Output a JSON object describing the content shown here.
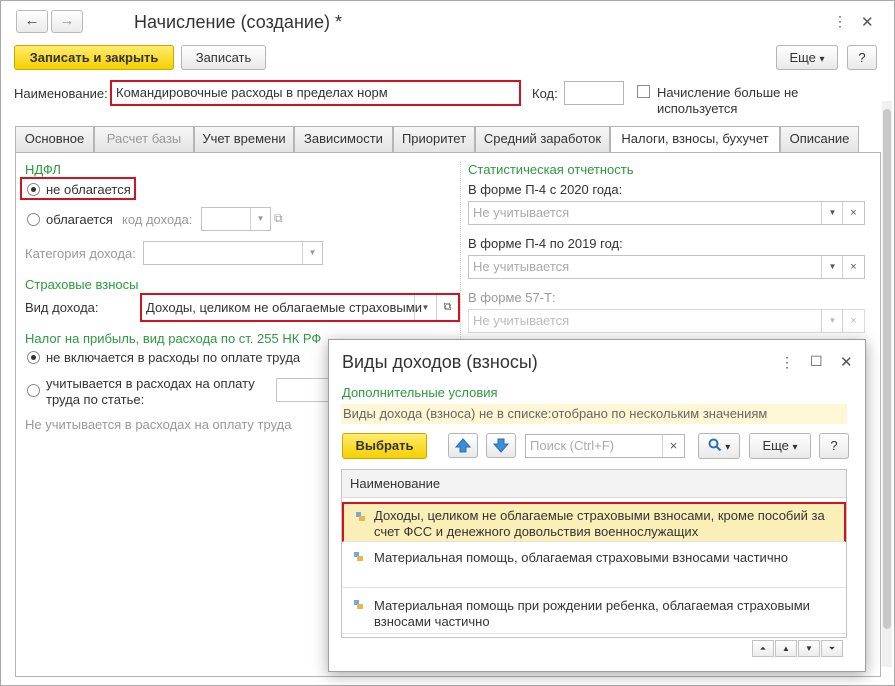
{
  "window": {
    "title": "Начисление (создание) *",
    "back_icon": "←",
    "forward_icon": "→",
    "more_icon": "⋮",
    "maximize_icon": "☐",
    "close_icon": "✕"
  },
  "toolbar": {
    "save_close_label": "Записать и закрыть",
    "save_label": "Записать",
    "more_label": "Еще",
    "more_arrow": "▾",
    "help_label": "?"
  },
  "header": {
    "name_label": "Наименование:",
    "name_value": "Командировочные расходы в пределах норм",
    "code_label": "Код:",
    "code_value": "",
    "unused_label_line1": "Начисление больше не",
    "unused_label_line2": "используется"
  },
  "tabs": [
    {
      "label": "Основное"
    },
    {
      "label": "Расчет базы"
    },
    {
      "label": "Учет времени"
    },
    {
      "label": "Зависимости"
    },
    {
      "label": "Приоритет"
    },
    {
      "label": "Средний заработок"
    },
    {
      "label": "Налоги, взносы, бухучет"
    },
    {
      "label": "Описание"
    }
  ],
  "left": {
    "ndfl_title": "НДФЛ",
    "not_taxed_label": "не облагается",
    "taxed_label": "облагается",
    "income_code_label": "код дохода:",
    "income_category_label": "Категория дохода:",
    "insurance_title": "Страховые взносы",
    "income_type_label": "Вид дохода:",
    "income_type_value": "Доходы, целиком не облагаемые страховыми",
    "profit_tax_title": "Налог на прибыль, вид расхода по ст. 255 НК РФ",
    "not_included_label": "не включается в расходы по оплате труда",
    "included_label_line1": "учитывается в расходах на оплату",
    "included_label_line2": "труда по статье:",
    "not_counted_text": "Не учитывается в расходах на оплату труда"
  },
  "right": {
    "stat_title": "Статистическая отчетность",
    "p4_2020_label": "В форме П-4 с 2020 года:",
    "p4_2020_value": "Не учитывается",
    "p4_2019_label": "В форме П-4 по 2019 год:",
    "p4_2019_value": "Не учитывается",
    "f57t_label": "В форме 57-Т:",
    "f57t_value": "Не учитывается"
  },
  "popup": {
    "title": "Виды доходов (взносы)",
    "more_icon": "⋮",
    "maximize_icon": "☐",
    "close_icon": "✕",
    "extra_conditions": "Дополнительные условия",
    "filter_text": "Виды дохода (взноса) не в списке:отобрано по нескольким значениям",
    "select_label": "Выбрать",
    "search_placeholder": "Поиск (Ctrl+F)",
    "search_clear": "×",
    "more_label": "Еще",
    "more_arrow": "▾",
    "help_label": "?",
    "column_header": "Наименование",
    "rows": [
      {
        "line1": "Доходы, целиком не облагаемые страховыми взносами, кроме пособий за",
        "line2": "счет ФСС и денежного довольствия военнослужащих"
      },
      {
        "line1": "Материальная помощь, облагаемая страховыми взносами частично",
        "line2": ""
      },
      {
        "line1": "Материальная помощь при рождении ребенка, облагаемая страховыми",
        "line2": "взносами частично"
      }
    ]
  },
  "colors": {
    "accent_yellow": "#f5d000",
    "highlight_red": "#d0131f",
    "section_green": "#2a9a3c",
    "selected_row": "#fbefb8"
  }
}
